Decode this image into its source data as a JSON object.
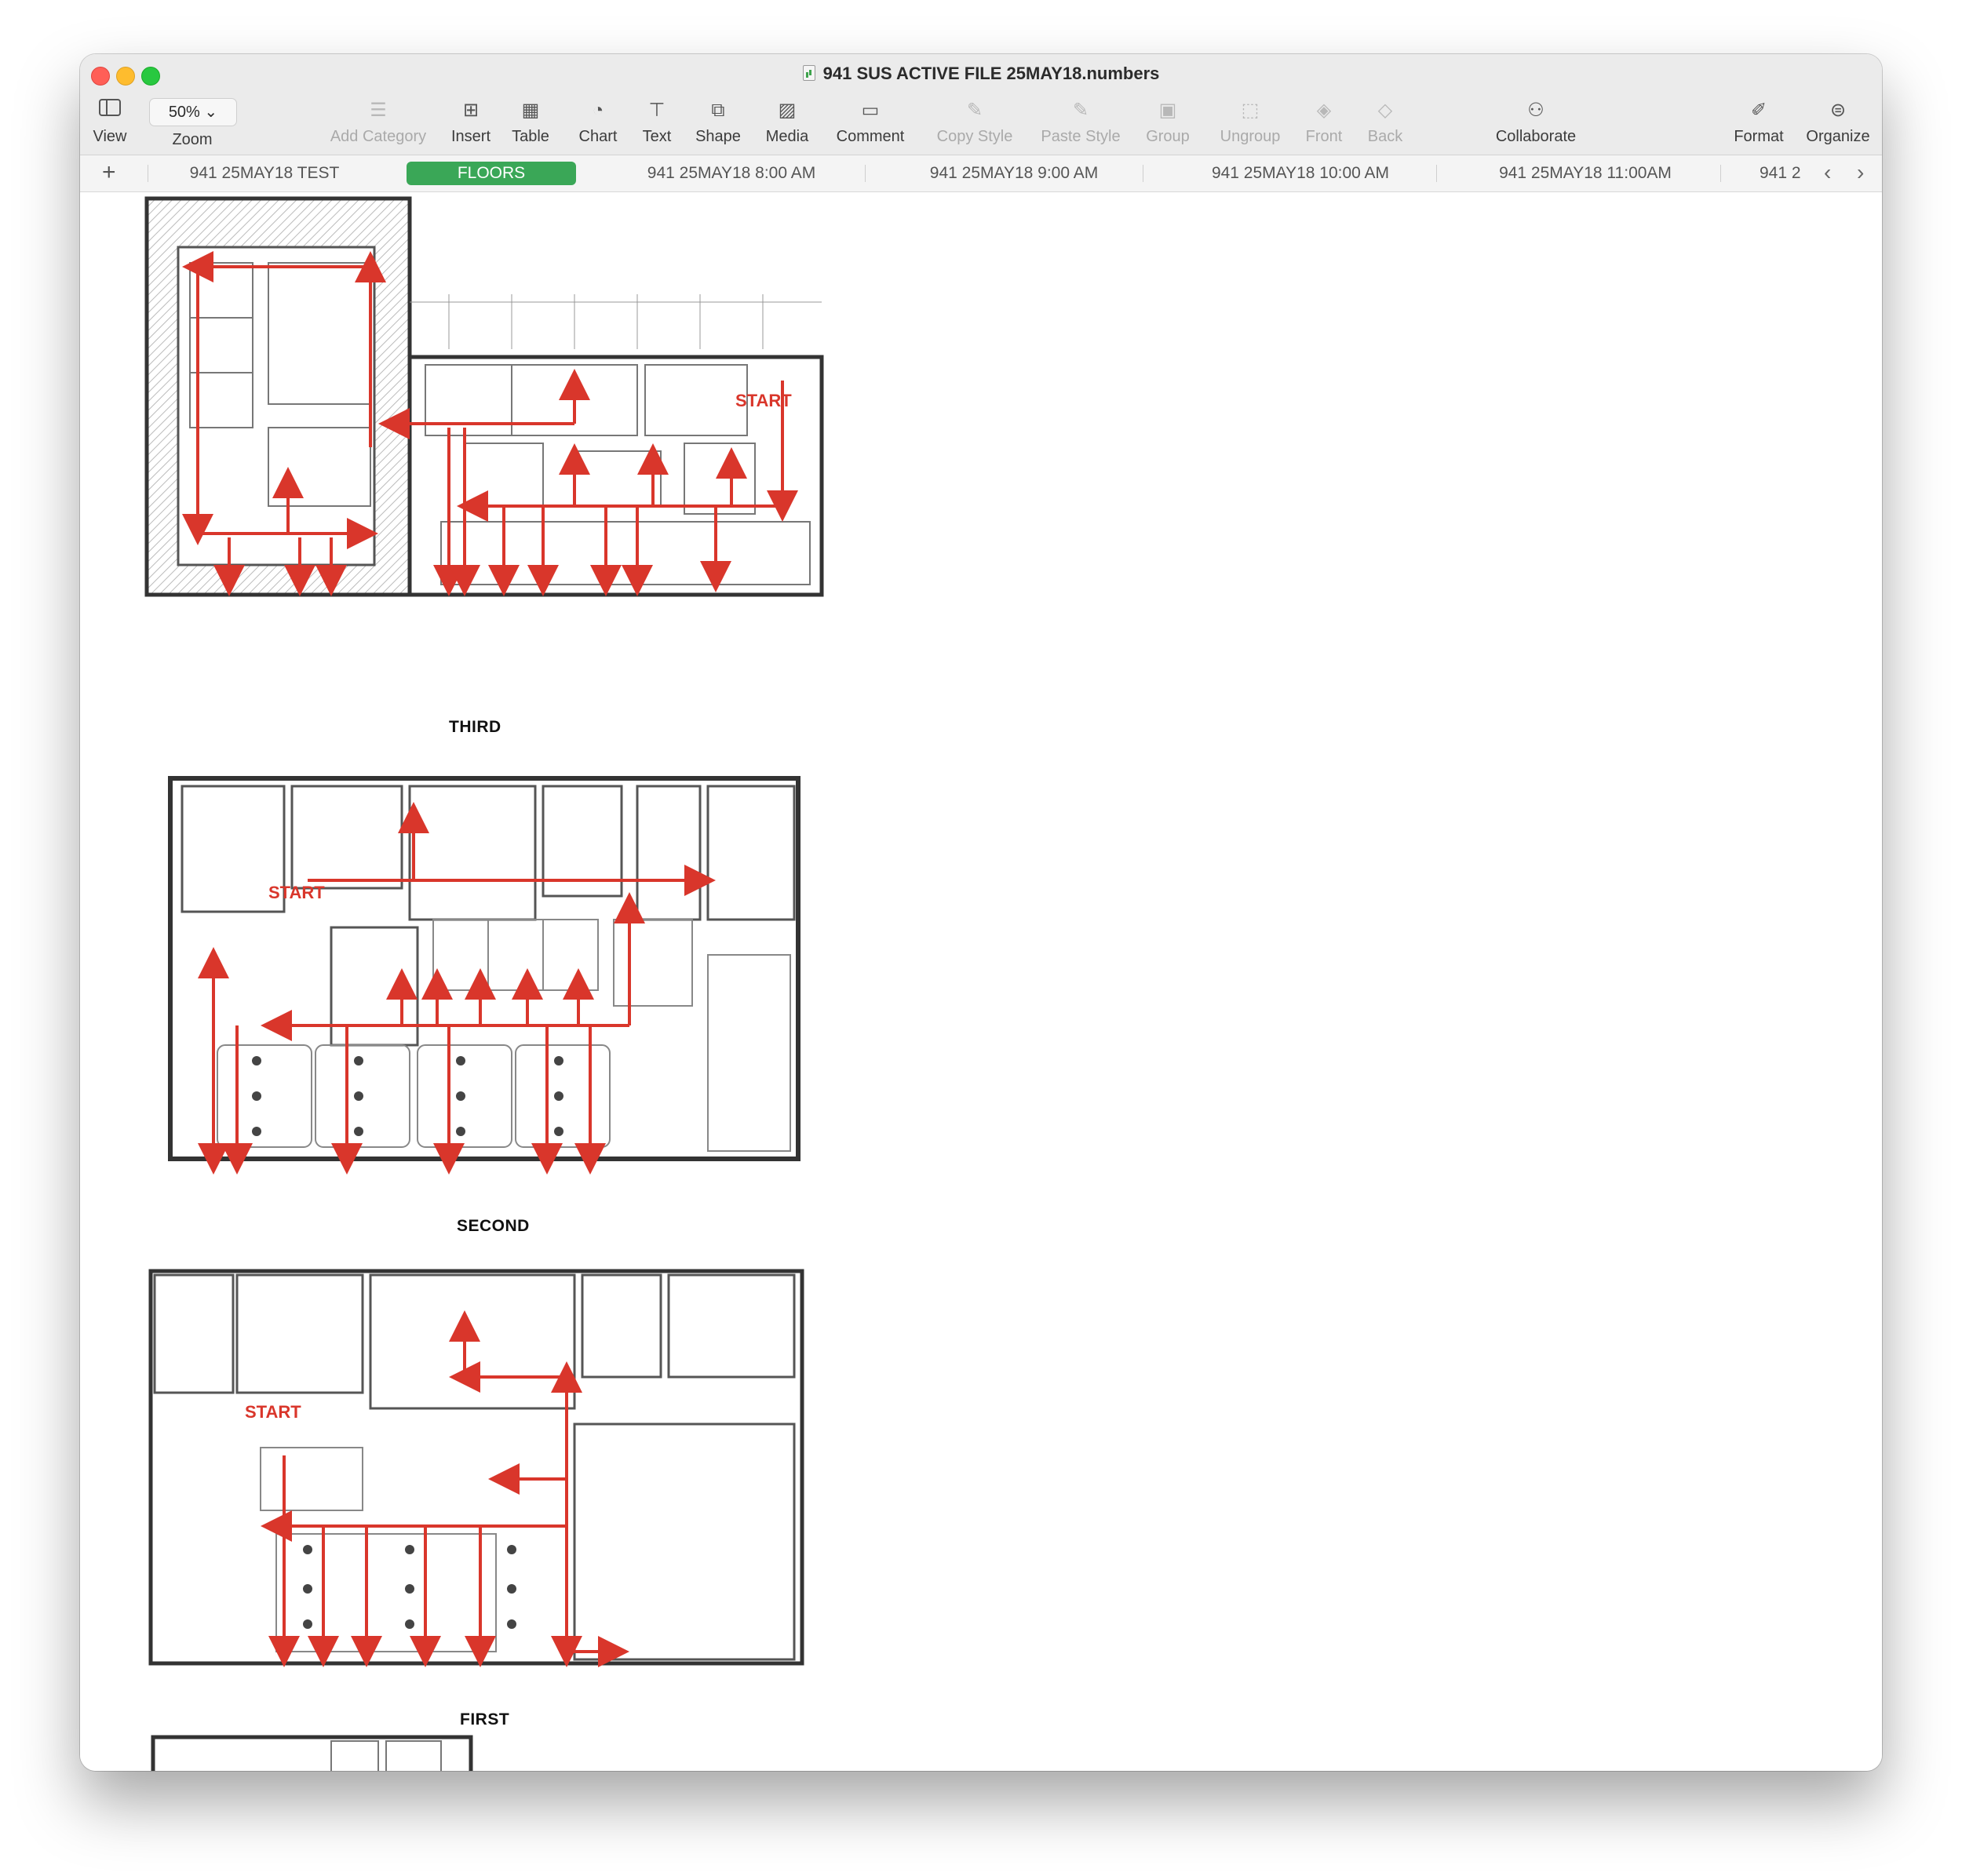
{
  "window": {
    "title": "941 SUS ACTIVE FILE 25MAY18.numbers"
  },
  "toolbar": {
    "view": "View",
    "zoom_value": "50%",
    "zoom": "Zoom",
    "add_category": "Add Category",
    "insert": "Insert",
    "table": "Table",
    "chart": "Chart",
    "text": "Text",
    "shape": "Shape",
    "media": "Media",
    "comment": "Comment",
    "copy_style": "Copy Style",
    "paste_style": "Paste Style",
    "group": "Group",
    "ungroup": "Ungroup",
    "front": "Front",
    "back": "Back",
    "collaborate": "Collaborate",
    "format": "Format",
    "organize": "Organize"
  },
  "sheets": {
    "tabs": [
      "941 25MAY18 TEST",
      "FLOORS",
      "941 25MAY18 8:00 AM",
      "941 25MAY18 9:00 AM",
      "941 25MAY18 10:00 AM",
      "941 25MAY18 11:00AM",
      "941 2"
    ],
    "active": "FLOORS"
  },
  "floors": {
    "third": {
      "label": "THIRD",
      "start": "START"
    },
    "second": {
      "label": "SECOND",
      "start": "START"
    },
    "first": {
      "label": "FIRST",
      "start": "START"
    }
  },
  "colors": {
    "active_tab": "#3aa757",
    "route": "#d9362b",
    "walls": "#3a3a3a"
  }
}
